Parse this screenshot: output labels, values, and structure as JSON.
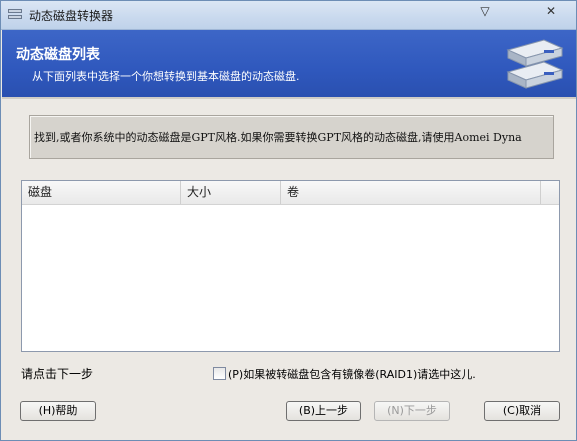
{
  "window": {
    "title": "动态磁盘转换器",
    "min_glyph": "▽",
    "close_glyph": "✕"
  },
  "header": {
    "title": "动态磁盘列表",
    "subtitle": "从下面列表中选择一个你想转换到基本磁盘的动态磁盘."
  },
  "info": {
    "text": "找到,或者你系统中的动态磁盘是GPT风格.如果你需要转换GPT风格的动态磁盘,请使用Aomei Dyna"
  },
  "list": {
    "columns": [
      "磁盘",
      "大小",
      "卷"
    ],
    "rows": []
  },
  "footer": {
    "hint": "请点击下一步",
    "checkbox_label": "(P)如果被转磁盘包含有镜像卷(RAID1)请选中这儿.",
    "checkbox_checked": false
  },
  "buttons": {
    "help": "(H)帮助",
    "back": "(B)上一步",
    "next": "(N)下一步",
    "cancel": "(C)取消"
  },
  "colors": {
    "header_bg": "#2f58bd",
    "header_text": "#ffffff",
    "window_bg": "#ece9e4"
  }
}
